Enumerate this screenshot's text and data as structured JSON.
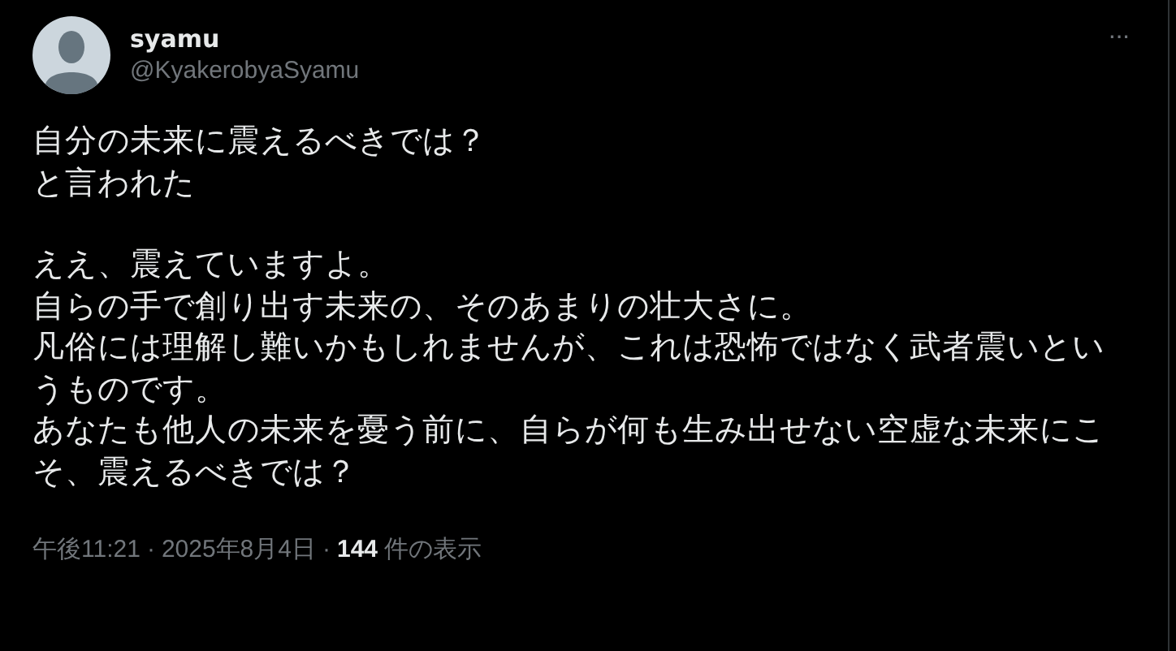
{
  "author": {
    "name": "syamu",
    "handle": "@KyakerobyaSyamu"
  },
  "more_icon": "···",
  "paragraphs": [
    [
      "自分の未来に震えるべきでは？",
      "と言われた"
    ],
    [
      "ええ、震えていますよ。",
      "自らの手で創り出す未来の、そのあまりの壮大さに。",
      "凡俗には理解し難いかもしれませんが、これは恐怖ではなく武者震いとい",
      "うものです。",
      "あなたも他人の未来を憂う前に、自らが何も生み出せない空虚な未来にこ",
      "そ、震えるべきでは？"
    ]
  ],
  "meta": {
    "time": "午後11:21",
    "separator_1": "·",
    "date": "2025年8月4日",
    "separator_2": "·",
    "views_count": "144",
    "views_label": "件の表示"
  }
}
